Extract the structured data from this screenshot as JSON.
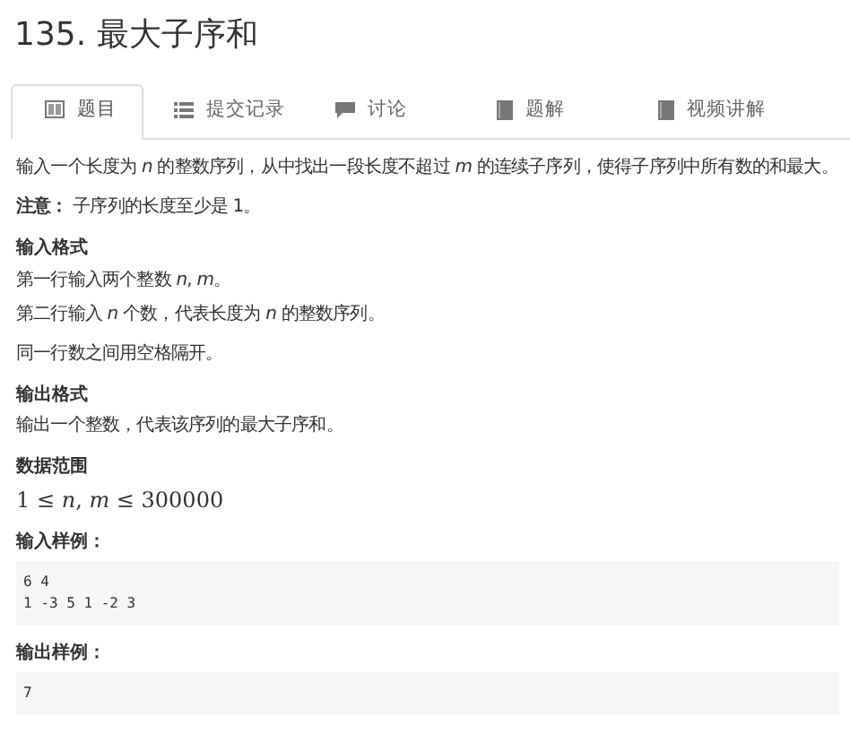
{
  "title": "135. 最大子序和",
  "tabs": [
    {
      "label": "题目",
      "selected": true
    },
    {
      "label": "提交记录",
      "selected": false
    },
    {
      "label": "讨论",
      "selected": false
    },
    {
      "label": "题解",
      "selected": false
    },
    {
      "label": "视频讲解",
      "selected": false
    }
  ],
  "content": [
    {
      "kind": "paragraph",
      "text": "输入一个长度为 *n* 的整数序列，从中找出一段长度不超过 *m* 的连续子序列，使得子序列中所有数的和最大。"
    },
    {
      "kind": "paragraph",
      "text": "**注意：** 子序列的长度至少是 1。"
    },
    {
      "kind": "heading",
      "text": "输入格式"
    },
    {
      "kind": "line",
      "text": "第一行输入两个整数 *n*, *m*。"
    },
    {
      "kind": "paragraph",
      "text": "第二行输入 *n* 个数，代表长度为 *n* 的整数序列。"
    },
    {
      "kind": "paragraph",
      "text": "同一行数之间用空格隔开。"
    },
    {
      "kind": "heading",
      "text": "输出格式"
    },
    {
      "kind": "paragraph",
      "text": "输出一个整数，代表该序列的最大子序和。"
    },
    {
      "kind": "heading",
      "text": "数据范围"
    },
    {
      "kind": "math",
      "text": "1 ≤ *n*, *m* ≤ 300000"
    },
    {
      "kind": "heading",
      "text": "输入样例："
    },
    {
      "kind": "code",
      "lines": [
        "6 4",
        "1 -3 5 1 -2 3"
      ]
    },
    {
      "kind": "heading",
      "text": "输出样例："
    },
    {
      "kind": "code",
      "lines": [
        "7"
      ]
    }
  ]
}
